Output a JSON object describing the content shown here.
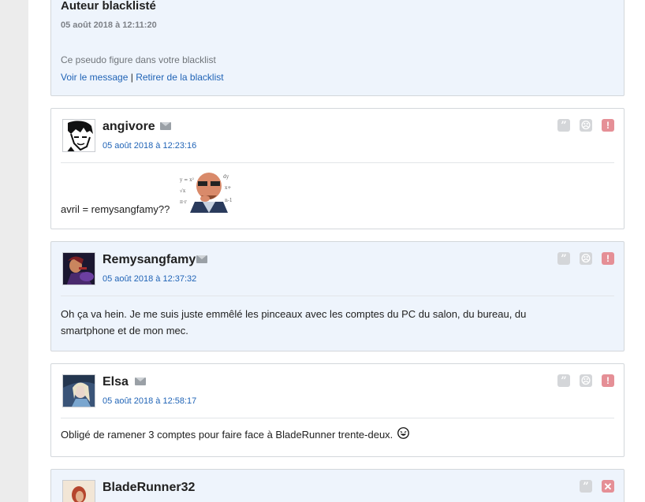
{
  "blacklist": {
    "title": "Auteur blacklisté",
    "date": "05 août 2018 à 12:11:20",
    "notice": "Ce pseudo figure dans votre blacklist",
    "view_link": "Voir le message",
    "separator": "|",
    "remove_link": "Retirer de la blacklist"
  },
  "posts": [
    {
      "author": "angivore",
      "date": "05 août 2018 à 12:23:16",
      "text": "avril = remysangfamy??",
      "sticker": "risitas-sticker"
    },
    {
      "author": "Remysangfamy",
      "date": "05 août 2018 à 12:37:32",
      "text": "Oh ça va hein. Je me suis juste emmêlé les pinceaux avec les comptes du PC du salon, du bureau, du smartphone et de mon mec."
    },
    {
      "author": "Elsa",
      "date": "05 août 2018 à 12:58:17",
      "text": "Obligé de ramener 3 comptes pour faire face à BladeRunner trente-deux.",
      "smiley": "laughing-smiley"
    },
    {
      "author": "BladeRunner32"
    }
  ],
  "icons": {
    "quote": "quote-icon",
    "mp": "envelope-icon",
    "blacklist": "frown-icon",
    "alert": "alert-icon",
    "delete": "delete-icon"
  }
}
